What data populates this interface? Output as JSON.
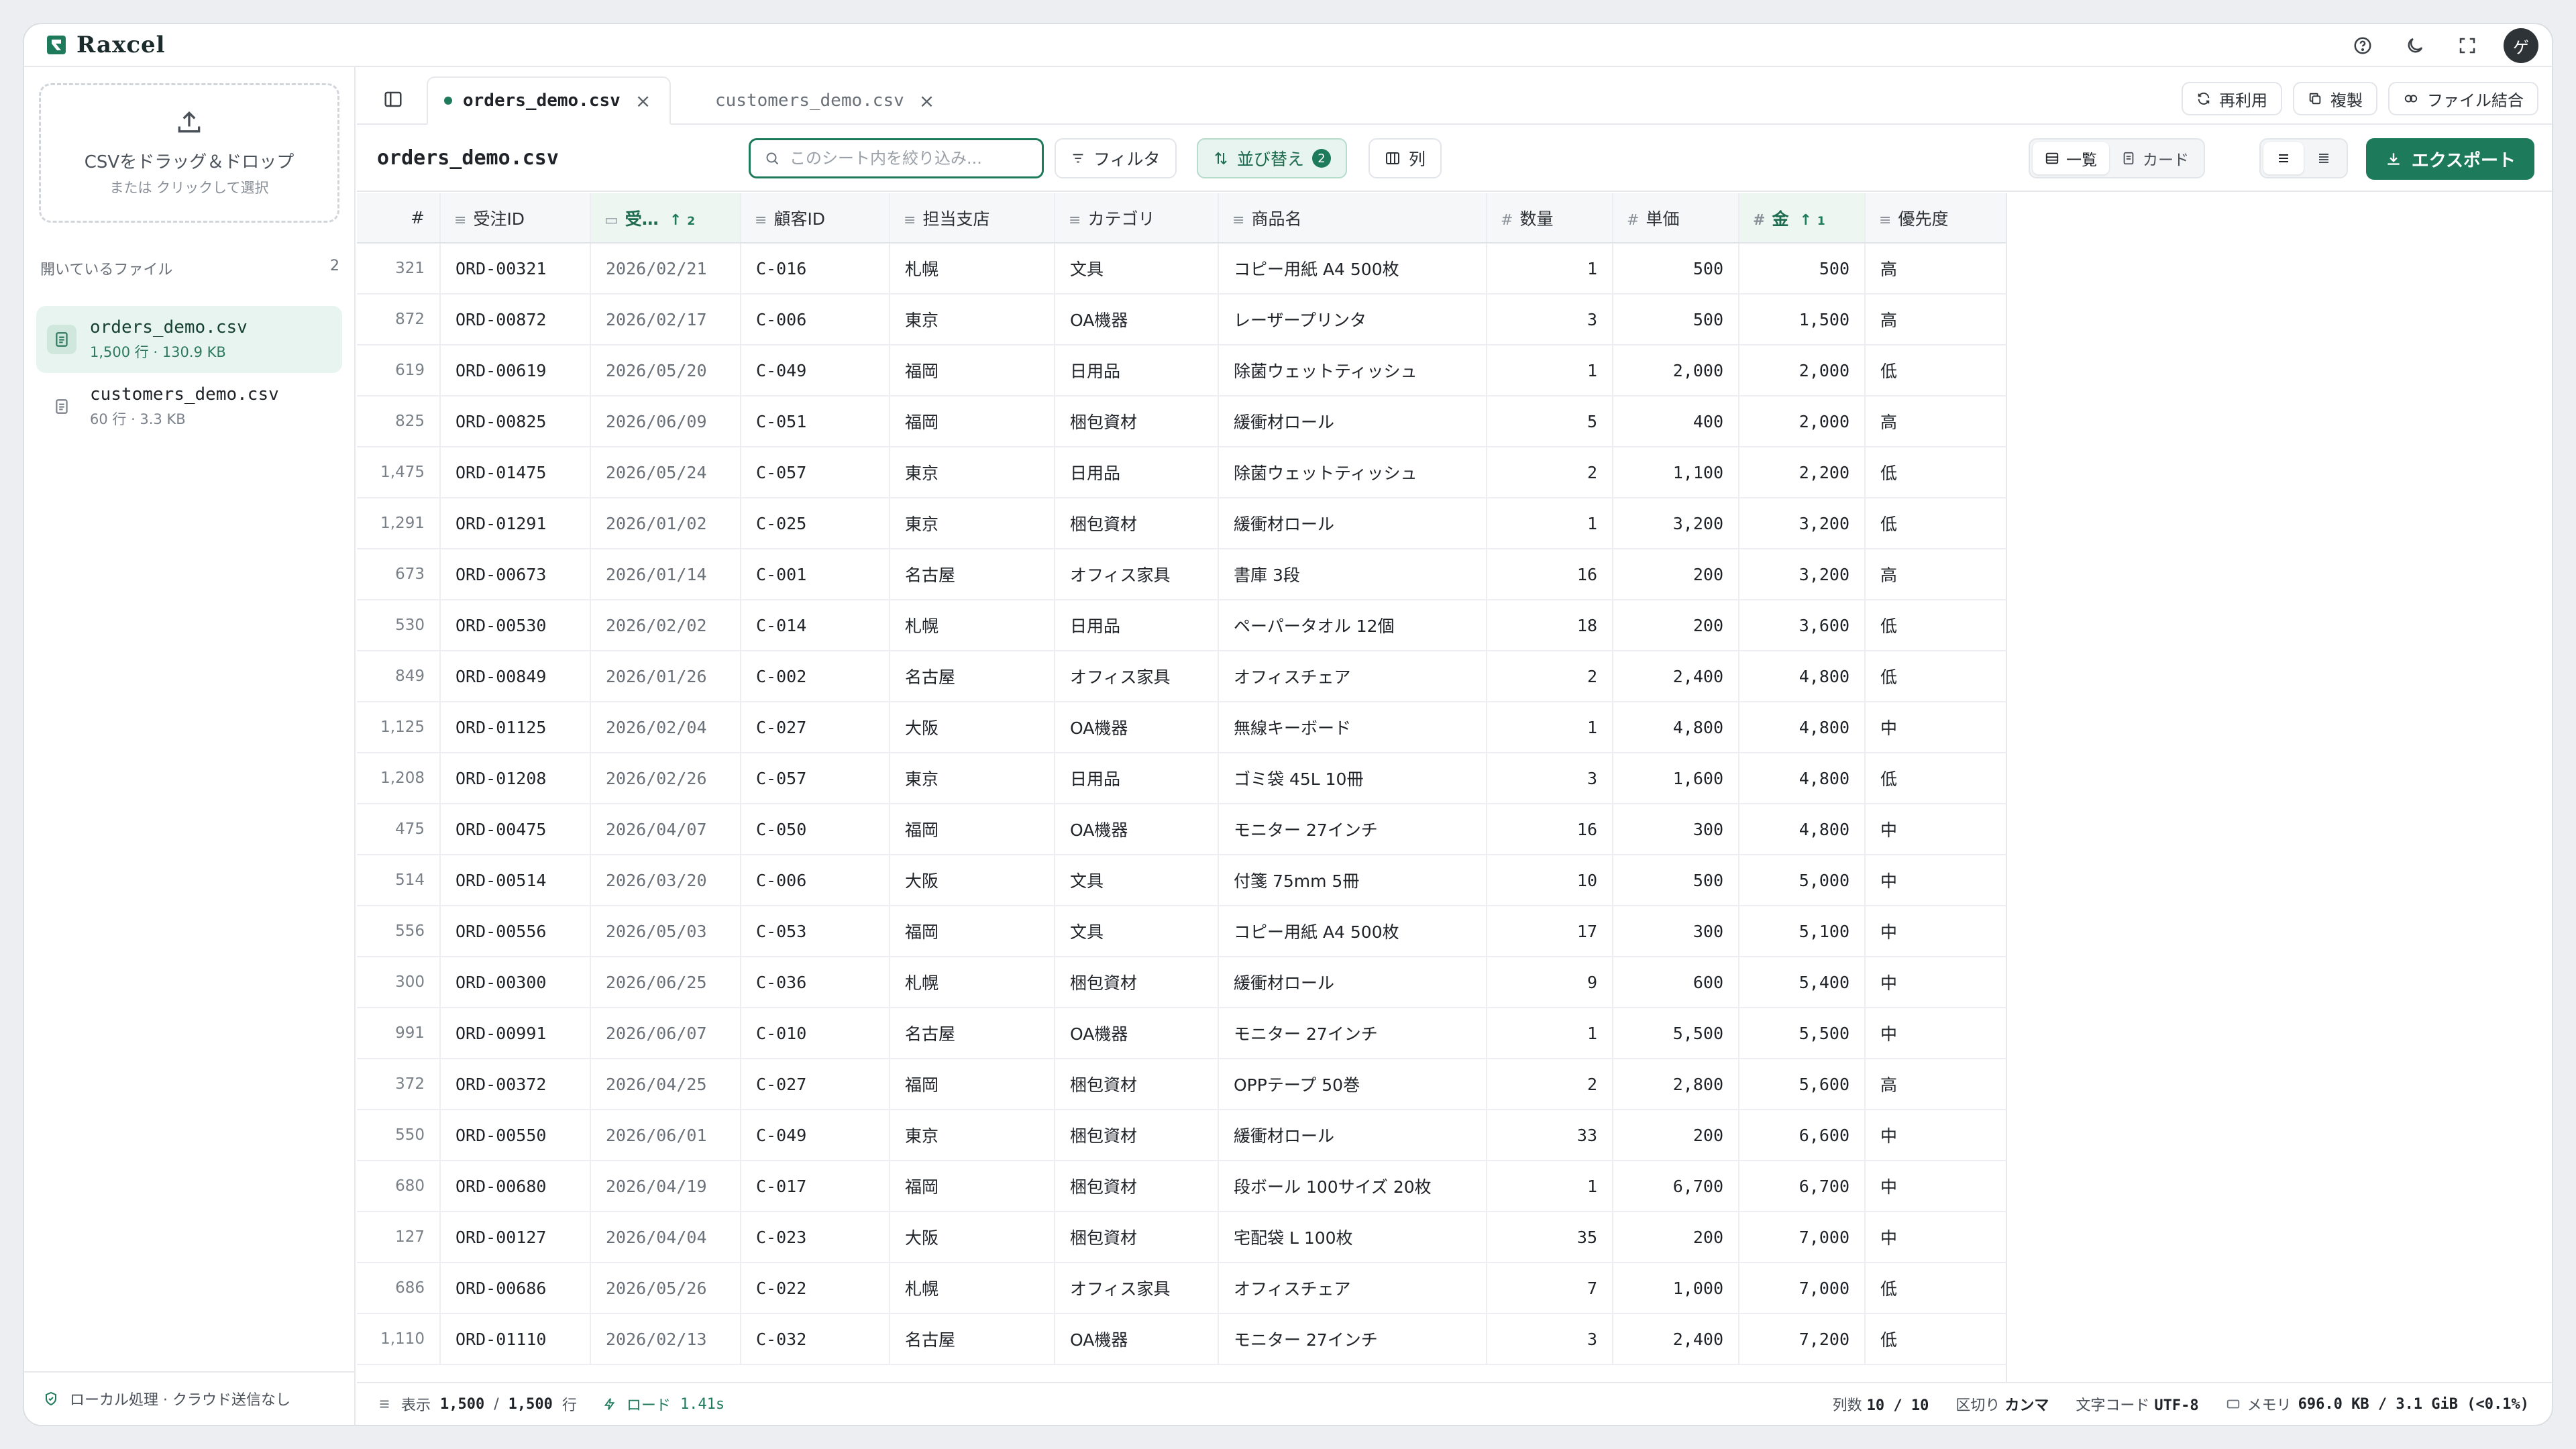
{
  "app": {
    "name": "Raxcel"
  },
  "sidebar": {
    "dropzone": {
      "title": "CSVをドラッグ＆ドロップ",
      "subtitle": "または クリックして選択"
    },
    "section_label": "開いているファイル",
    "section_count": "2",
    "files": [
      {
        "name": "orders_demo.csv",
        "meta": "1,500 行 · 130.9 KB"
      },
      {
        "name": "customers_demo.csv",
        "meta": "60 行 · 3.3 KB"
      }
    ],
    "footer": "ローカル処理 · クラウド送信なし"
  },
  "tabs": [
    {
      "label": "orders_demo.csv"
    },
    {
      "label": "customers_demo.csv"
    }
  ],
  "tab_actions": {
    "reuse": "再利用",
    "duplicate": "複製",
    "join": "ファイル結合"
  },
  "toolbar": {
    "sheet_title": "orders_demo.csv",
    "search_placeholder": "このシート内を絞り込み...",
    "filter": "フィルタ",
    "sort": "並び替え",
    "sort_count": "2",
    "columns": "列",
    "view_list": "一覧",
    "view_card": "カード",
    "export": "エクスポート"
  },
  "table": {
    "headers": {
      "rownum": "#",
      "order_id": "受注ID",
      "date": "受…",
      "date_sort_order": "2",
      "customer_id": "顧客ID",
      "branch": "担当支店",
      "category": "カテゴリ",
      "product": "商品名",
      "qty": "数量",
      "unit_price": "単価",
      "amount": "金",
      "amount_sort_order": "1",
      "priority": "優先度"
    },
    "rows": [
      [
        "321",
        "ORD-00321",
        "2026/02/21",
        "C-016",
        "札幌",
        "文具",
        "コピー用紙 A4 500枚",
        "1",
        "500",
        "500",
        "高"
      ],
      [
        "872",
        "ORD-00872",
        "2026/02/17",
        "C-006",
        "東京",
        "OA機器",
        "レーザープリンタ",
        "3",
        "500",
        "1,500",
        "高"
      ],
      [
        "619",
        "ORD-00619",
        "2026/05/20",
        "C-049",
        "福岡",
        "日用品",
        "除菌ウェットティッシュ",
        "1",
        "2,000",
        "2,000",
        "低"
      ],
      [
        "825",
        "ORD-00825",
        "2026/06/09",
        "C-051",
        "福岡",
        "梱包資材",
        "緩衝材ロール",
        "5",
        "400",
        "2,000",
        "高"
      ],
      [
        "1,475",
        "ORD-01475",
        "2026/05/24",
        "C-057",
        "東京",
        "日用品",
        "除菌ウェットティッシュ",
        "2",
        "1,100",
        "2,200",
        "低"
      ],
      [
        "1,291",
        "ORD-01291",
        "2026/01/02",
        "C-025",
        "東京",
        "梱包資材",
        "緩衝材ロール",
        "1",
        "3,200",
        "3,200",
        "低"
      ],
      [
        "673",
        "ORD-00673",
        "2026/01/14",
        "C-001",
        "名古屋",
        "オフィス家具",
        "書庫 3段",
        "16",
        "200",
        "3,200",
        "高"
      ],
      [
        "530",
        "ORD-00530",
        "2026/02/02",
        "C-014",
        "札幌",
        "日用品",
        "ペーパータオル 12個",
        "18",
        "200",
        "3,600",
        "低"
      ],
      [
        "849",
        "ORD-00849",
        "2026/01/26",
        "C-002",
        "名古屋",
        "オフィス家具",
        "オフィスチェア",
        "2",
        "2,400",
        "4,800",
        "低"
      ],
      [
        "1,125",
        "ORD-01125",
        "2026/02/04",
        "C-027",
        "大阪",
        "OA機器",
        "無線キーボード",
        "1",
        "4,800",
        "4,800",
        "中"
      ],
      [
        "1,208",
        "ORD-01208",
        "2026/02/26",
        "C-057",
        "東京",
        "日用品",
        "ゴミ袋 45L 10冊",
        "3",
        "1,600",
        "4,800",
        "低"
      ],
      [
        "475",
        "ORD-00475",
        "2026/04/07",
        "C-050",
        "福岡",
        "OA機器",
        "モニター 27インチ",
        "16",
        "300",
        "4,800",
        "中"
      ],
      [
        "514",
        "ORD-00514",
        "2026/03/20",
        "C-006",
        "大阪",
        "文具",
        "付箋 75mm 5冊",
        "10",
        "500",
        "5,000",
        "中"
      ],
      [
        "556",
        "ORD-00556",
        "2026/05/03",
        "C-053",
        "福岡",
        "文具",
        "コピー用紙 A4 500枚",
        "17",
        "300",
        "5,100",
        "中"
      ],
      [
        "300",
        "ORD-00300",
        "2026/06/25",
        "C-036",
        "札幌",
        "梱包資材",
        "緩衝材ロール",
        "9",
        "600",
        "5,400",
        "中"
      ],
      [
        "991",
        "ORD-00991",
        "2026/06/07",
        "C-010",
        "名古屋",
        "OA機器",
        "モニター 27インチ",
        "1",
        "5,500",
        "5,500",
        "中"
      ],
      [
        "372",
        "ORD-00372",
        "2026/04/25",
        "C-027",
        "福岡",
        "梱包資材",
        "OPPテープ 50巻",
        "2",
        "2,800",
        "5,600",
        "高"
      ],
      [
        "550",
        "ORD-00550",
        "2026/06/01",
        "C-049",
        "東京",
        "梱包資材",
        "緩衝材ロール",
        "33",
        "200",
        "6,600",
        "中"
      ],
      [
        "680",
        "ORD-00680",
        "2026/04/19",
        "C-017",
        "福岡",
        "梱包資材",
        "段ボール 100サイズ 20枚",
        "1",
        "6,700",
        "6,700",
        "中"
      ],
      [
        "127",
        "ORD-00127",
        "2026/04/04",
        "C-023",
        "大阪",
        "梱包資材",
        "宅配袋 L 100枚",
        "35",
        "200",
        "7,000",
        "中"
      ],
      [
        "686",
        "ORD-00686",
        "2026/05/26",
        "C-022",
        "札幌",
        "オフィス家具",
        "オフィスチェア",
        "7",
        "1,000",
        "7,000",
        "低"
      ],
      [
        "1,110",
        "ORD-01110",
        "2026/02/13",
        "C-032",
        "名古屋",
        "OA機器",
        "モニター 27インチ",
        "3",
        "2,400",
        "7,200",
        "低"
      ]
    ]
  },
  "statusbar": {
    "display_label": "表示",
    "shown": "1,500",
    "total": "1,500",
    "rows_unit": "行",
    "load_label": "ロード",
    "load_time": "1.41s",
    "cols_label": "列数",
    "cols_value": "10 / 10",
    "delimiter_label": "区切り",
    "delimiter_value": "カンマ",
    "encoding_label": "文字コード",
    "encoding_value": "UTF-8",
    "memory_label": "メモリ",
    "memory_value": "696.0 KB / 3.1 GiB (<0.1%)"
  }
}
